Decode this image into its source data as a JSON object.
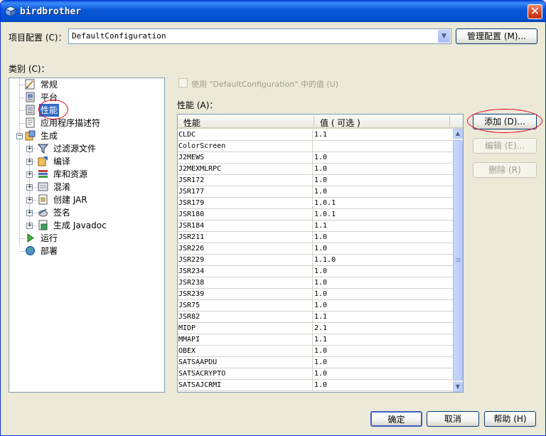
{
  "window": {
    "title": "birdbrother"
  },
  "config": {
    "label": "项目配置 (C)：",
    "value": "DefaultConfiguration",
    "manage_label": "管理配置 (M)..."
  },
  "category": {
    "label": "类别 (C)：",
    "items": [
      {
        "label": "常规",
        "icon": "general-icon"
      },
      {
        "label": "平台",
        "icon": "platform-icon"
      },
      {
        "label": "性能",
        "icon": "abilities-icon",
        "selected": true
      },
      {
        "label": "应用程序描述符",
        "icon": "descriptor-icon"
      },
      {
        "label": "生成",
        "icon": "build-icon",
        "expanded": true
      },
      {
        "label": "过滤源文件",
        "icon": "filter-icon"
      },
      {
        "label": "编译",
        "icon": "compile-icon"
      },
      {
        "label": "库和资源",
        "icon": "libraries-icon"
      },
      {
        "label": "混淆",
        "icon": "obfuscate-icon"
      },
      {
        "label": "创建 JAR",
        "icon": "jar-icon"
      },
      {
        "label": "签名",
        "icon": "sign-icon"
      },
      {
        "label": "生成 Javadoc",
        "icon": "javadoc-icon"
      },
      {
        "label": "运行",
        "icon": "run-icon"
      },
      {
        "label": "部署",
        "icon": "deploy-icon"
      }
    ]
  },
  "use_default_label": "使用 \"DefaultConfiguration\" 中的值 (U)",
  "abilities": {
    "label": "性能 (A)：",
    "columns": [
      "性能",
      "值 ( 可选 )"
    ],
    "rows": [
      [
        "CLDC",
        "1.1"
      ],
      [
        "ColorScreen",
        ""
      ],
      [
        "J2MEWS",
        "1.0"
      ],
      [
        "J2MEXMLRPC",
        "1.0"
      ],
      [
        "JSR172",
        "1.0"
      ],
      [
        "JSR177",
        "1.0"
      ],
      [
        "JSR179",
        "1.0.1"
      ],
      [
        "JSR180",
        "1.0.1"
      ],
      [
        "JSR184",
        "1.1"
      ],
      [
        "JSR211",
        "1.0"
      ],
      [
        "JSR226",
        "1.0"
      ],
      [
        "JSR229",
        "1.1.0"
      ],
      [
        "JSR234",
        "1.0"
      ],
      [
        "JSR238",
        "1.0"
      ],
      [
        "JSR239",
        "1.0"
      ],
      [
        "JSR75",
        "1.0"
      ],
      [
        "JSR82",
        "1.1"
      ],
      [
        "MIDP",
        "2.1"
      ],
      [
        "MMAPI",
        "1.1"
      ],
      [
        "OBEX",
        "1.0"
      ],
      [
        "SATSAAPDU",
        "1.0"
      ],
      [
        "SATSACRYPTO",
        "1.0"
      ],
      [
        "SATSAJCRMI",
        "1.0"
      ]
    ]
  },
  "side_buttons": {
    "add": "添加 (D)...",
    "edit": "编辑 (E)...",
    "remove": "删除 (R)"
  },
  "footer": {
    "ok": "确定",
    "cancel": "取消",
    "help": "帮助 (H)"
  },
  "colors": {
    "title_blue": "#0050d0",
    "selection": "#316ac5",
    "annotation_red": "#e8001c",
    "face": "#ece9d8"
  }
}
